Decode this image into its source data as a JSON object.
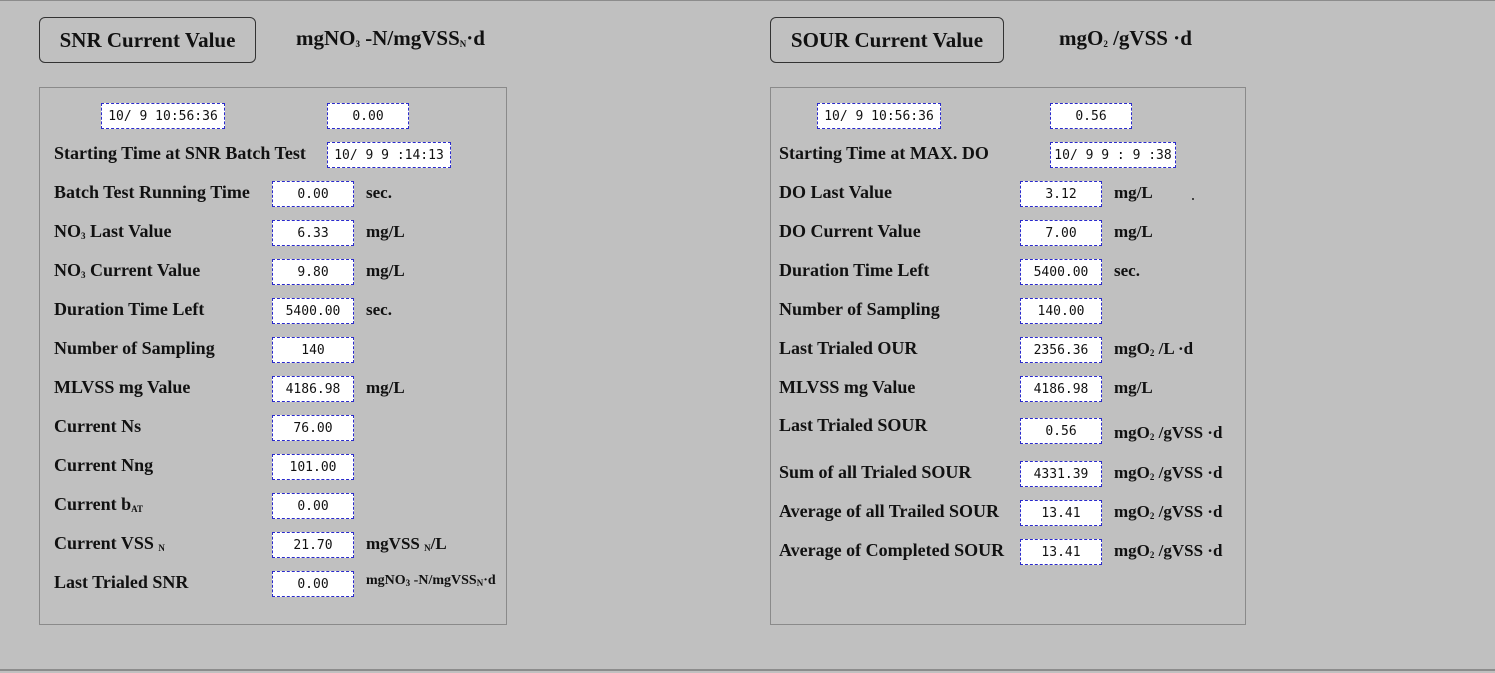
{
  "snr": {
    "header_button": "SNR Current Value",
    "unit_header": {
      "a": "mgNO",
      "a_sub": "3",
      "b": " -N/mgVSS",
      "b_sub": "N",
      "c": "·d"
    },
    "datetime": "10/ 9  10:56:36",
    "current_value": "0.00",
    "rows": [
      {
        "label": "Starting Time at SNR Batch Test",
        "value": "10/ 9   9 :14:13",
        "unit": ""
      },
      {
        "label": "Batch Test Running Time",
        "value": "0.00",
        "unit": "sec."
      },
      {
        "label_a": "NO",
        "label_sub": "3",
        "label_b": " Last Value",
        "value": "6.33",
        "unit": "mg/L"
      },
      {
        "label_a": "NO",
        "label_sub": "3",
        "label_b": " Current Value",
        "value": "9.80",
        "unit": "mg/L"
      },
      {
        "label": "Duration Time Left",
        "value": "5400.00",
        "unit": "sec."
      },
      {
        "label": "Number of Sampling",
        "value": "140",
        "unit": ""
      },
      {
        "label": "MLVSS mg Value",
        "value": "4186.98",
        "unit": "mg/L"
      },
      {
        "label": "Current Ns",
        "value": "76.00",
        "unit": ""
      },
      {
        "label": "Current Nng",
        "value": "101.00",
        "unit": ""
      },
      {
        "label_a": "Current b",
        "label_sub": "AT",
        "label_b": "",
        "value": "0.00",
        "unit": ""
      },
      {
        "label_a": "Current VSS",
        "label_sub": "N",
        "label_b": "",
        "value": "21.70",
        "unit_a": "mgVSS",
        "unit_sub": "N",
        "unit_b": "/L"
      },
      {
        "label": "Last Trialed SNR",
        "value": "0.00",
        "unit_a": "mgNO",
        "unit_sub": "3",
        "unit_b": " -N/mgVSS",
        "unit_sub2": "N",
        "unit_c": "·d"
      }
    ]
  },
  "sour": {
    "header_button": "SOUR Current Value",
    "unit_header": {
      "a": "mgO",
      "a_sub": "2",
      "b": " /gVSS ·d"
    },
    "datetime": "10/ 9  10:56:36",
    "current_value": "0.56",
    "rows": [
      {
        "label": "Starting Time at MAX. DO",
        "value": "10/ 9   9 : 9 :38",
        "unit": ""
      },
      {
        "label": "DO Last Value",
        "value": "3.12",
        "unit": "mg/L"
      },
      {
        "label": "DO Current Value",
        "value": "7.00",
        "unit": "mg/L"
      },
      {
        "label": "Duration Time Left",
        "value": "5400.00",
        "unit": "sec."
      },
      {
        "label": "Number of Sampling",
        "value": "140.00",
        "unit": ""
      },
      {
        "label": "Last Trialed OUR",
        "value": "2356.36",
        "unit_a": "mgO",
        "unit_sub": "2",
        "unit_b": " /L ·d"
      },
      {
        "label": "MLVSS mg Value",
        "value": "4186.98",
        "unit": "mg/L"
      },
      {
        "label": "Last Trialed SOUR",
        "value": "0.56",
        "unit_a": "mgO",
        "unit_sub": "2",
        "unit_b": " /gVSS ·d"
      },
      {
        "label": "Sum of all Trialed SOUR",
        "value": "4331.39",
        "unit_a": "mgO",
        "unit_sub": "2",
        "unit_b": " /gVSS ·d"
      },
      {
        "label": "Average of all Trailed SOUR",
        "value": "13.41",
        "unit_a": "mgO",
        "unit_sub": "2",
        "unit_b": " /gVSS ·d"
      },
      {
        "label": "Average of Completed SOUR",
        "value": "13.41",
        "unit_a": "mgO",
        "unit_sub": "2",
        "unit_b": " /gVSS ·d"
      }
    ]
  }
}
